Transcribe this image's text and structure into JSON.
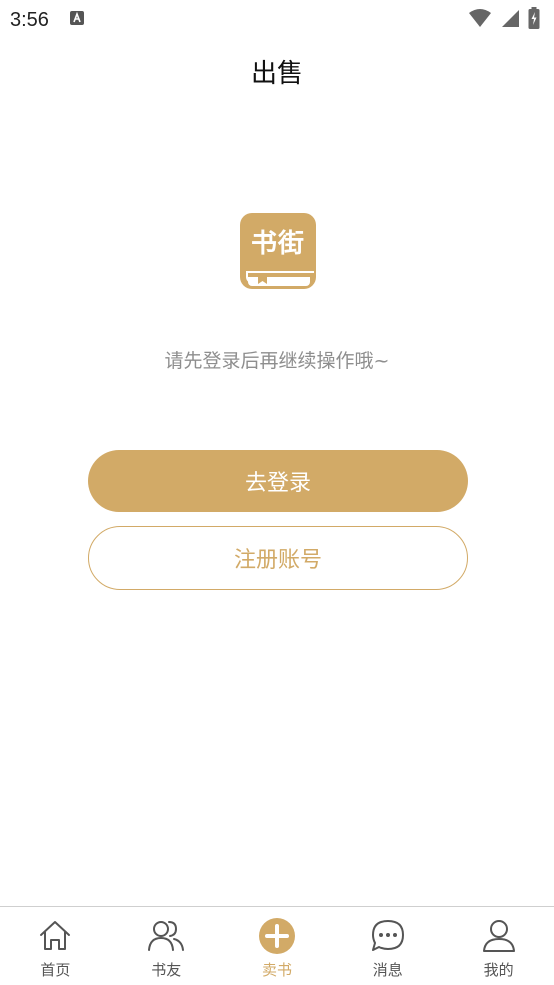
{
  "status_bar": {
    "time": "3:56"
  },
  "header": {
    "title": "出售"
  },
  "logo": {
    "text": "书街"
  },
  "main": {
    "prompt": "请先登录后再继续操作哦~",
    "login_label": "去登录",
    "register_label": "注册账号"
  },
  "colors": {
    "accent": "#d2aa67",
    "prompt_text": "#8e8e8e",
    "nav_text": "#555555"
  },
  "nav": {
    "items": [
      {
        "label": "首页",
        "icon": "home-icon"
      },
      {
        "label": "书友",
        "icon": "friends-icon"
      },
      {
        "label": "卖书",
        "icon": "plus-circle-icon",
        "active": true
      },
      {
        "label": "消息",
        "icon": "chat-bubble-icon"
      },
      {
        "label": "我的",
        "icon": "user-icon"
      }
    ]
  }
}
